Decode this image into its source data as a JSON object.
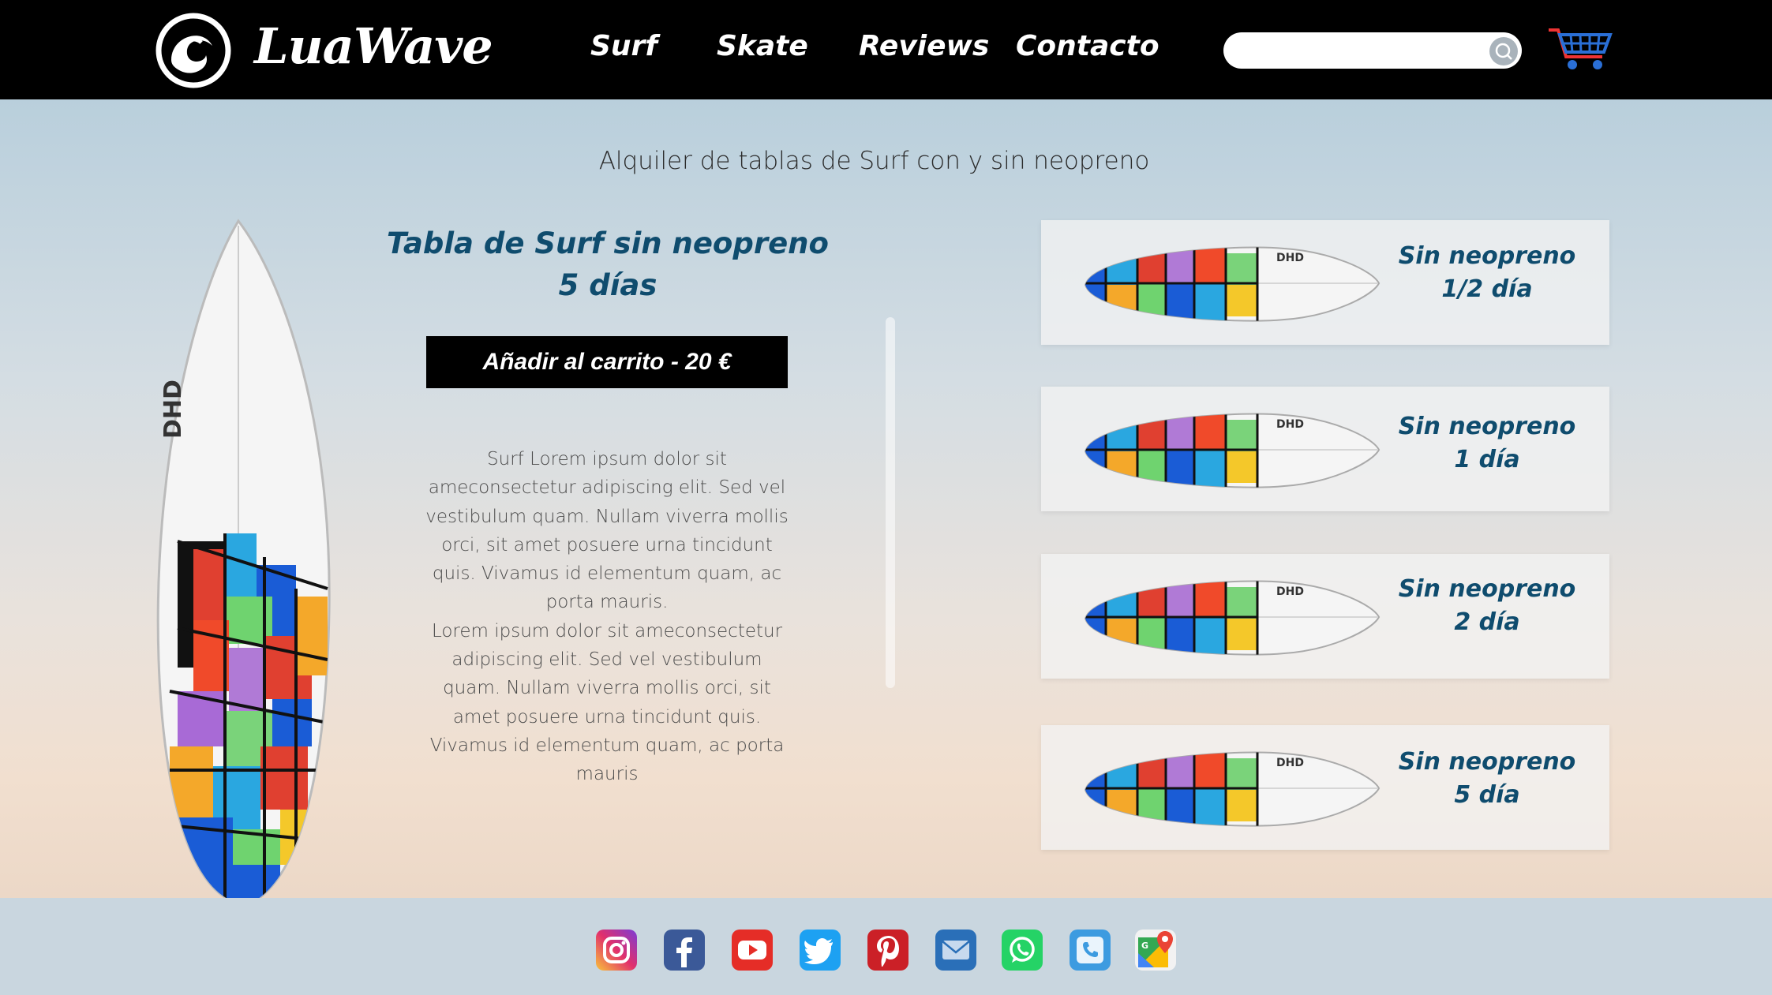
{
  "header": {
    "brand": "LuaWave",
    "nav": [
      "Surf",
      "Skate",
      "Reviews",
      "Contacto"
    ],
    "search_placeholder": ""
  },
  "main": {
    "subtitle": "Alquiler de tablas de Surf con y sin neopreno",
    "product": {
      "title_line1": "Tabla de Surf sin neopreno",
      "title_line2": "5 días",
      "add_to_cart": "Añadir al carrito - 20 €",
      "description_1": "Surf Lorem ipsum dolor sit ameconsectetur adipiscing elit. Sed vel vestibulum quam. Nullam viverra mollis orci, sit amet posuere urna tincidunt quis. Vivamus id elementum quam, ac porta mauris.",
      "description_2": "Lorem ipsum dolor sit ameconsectetur adipiscing elit. Sed vel vestibulum quam. Nullam viverra mollis orci, sit amet posuere urna tincidunt quis. Vivamus id elementum quam, ac porta mauris"
    },
    "options": [
      {
        "line1": "Sin neopreno",
        "line2": "1/2 día"
      },
      {
        "line1": "Sin neopreno",
        "line2": "1 día"
      },
      {
        "line1": "Sin neopreno",
        "line2": "2 día"
      },
      {
        "line1": "Sin neopreno",
        "line2": "5 día"
      }
    ]
  },
  "footer": {
    "social": [
      "instagram",
      "facebook",
      "youtube",
      "twitter",
      "pinterest",
      "email",
      "whatsapp",
      "phone",
      "google-maps"
    ]
  },
  "colors": {
    "accent": "#0f4c6e",
    "header_bg": "#000000",
    "footer_bg": "#c9d6df"
  }
}
